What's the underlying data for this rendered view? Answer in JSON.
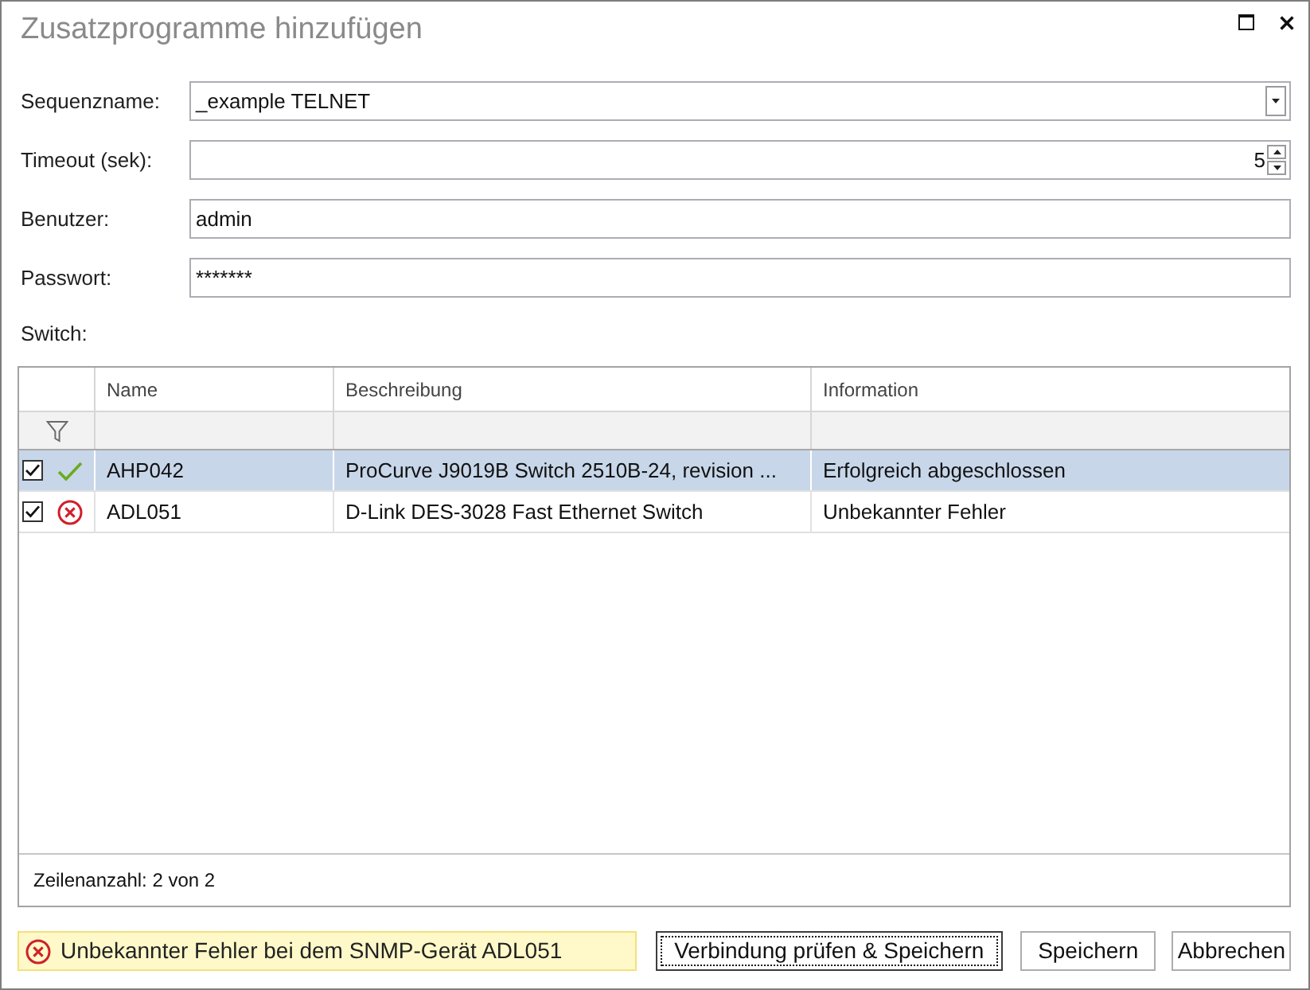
{
  "window": {
    "title": "Zusatzprogramme hinzufügen"
  },
  "fields": [
    {
      "label": "Sequenzname:",
      "kind": "dropdown",
      "value": "_example TELNET"
    },
    {
      "label": "Timeout (sek):",
      "kind": "spinner",
      "value": "5"
    },
    {
      "label": "Benutzer:",
      "kind": "text",
      "value": "admin"
    },
    {
      "label": "Passwort:",
      "kind": "password",
      "value": "*******"
    }
  ],
  "switch_label": "Switch:",
  "table": {
    "columns": [
      "Name",
      "Beschreibung",
      "Information"
    ],
    "rows": [
      {
        "selected": true,
        "checked": true,
        "kind": "success",
        "cells": [
          "AHP042",
          "ProCurve J9019B Switch 2510B-24, revision ...",
          "Erfolgreich abgeschlossen"
        ]
      },
      {
        "selected": false,
        "checked": true,
        "kind": "error",
        "cells": [
          "ADL051",
          "D-Link DES-3028 Fast Ethernet Switch",
          "Unbekannter Fehler"
        ]
      }
    ],
    "footer": "Zeilenanzahl: 2 von 2"
  },
  "message": {
    "kind": "error",
    "text": "Unbekannter Fehler bei dem SNMP-Gerät ADL051"
  },
  "buttons": [
    {
      "label": "Verbindung prüfen & Speichern",
      "focused": true
    },
    {
      "label": "Speichern",
      "focused": false
    },
    {
      "label": "Abbrechen",
      "focused": false
    }
  ]
}
